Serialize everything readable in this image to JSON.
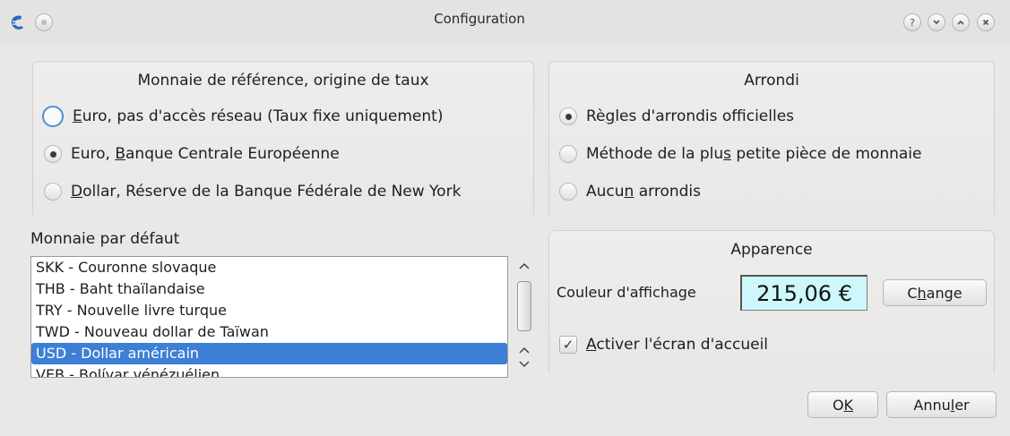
{
  "window": {
    "title": "Configuration",
    "controls": [
      "help-icon",
      "minimize-icon",
      "maximize-icon",
      "close-icon"
    ]
  },
  "reference": {
    "title": "Monnaie de référence, origine de taux",
    "options": [
      {
        "pre": "",
        "key": "E",
        "post": "uro, pas d'accès réseau (Taux fixe uniquement)",
        "checked": false,
        "focused": true
      },
      {
        "pre": "Euro, ",
        "key": "B",
        "post": "anque Centrale Européenne",
        "checked": true,
        "focused": false
      },
      {
        "pre": "",
        "key": "D",
        "post": "ollar, Réserve de la Banque Fédérale de New York",
        "checked": false,
        "focused": false
      }
    ]
  },
  "rounding": {
    "title": "Arrondi",
    "options": [
      {
        "pre": "Rè",
        "key": "g",
        "post": "les d'arrondis officielles",
        "checked": true
      },
      {
        "pre": "Méthode de la plu",
        "key": "s",
        "post": " petite pièce de monnaie",
        "checked": false
      },
      {
        "pre": "Aucu",
        "key": "n",
        "post": " arrondis",
        "checked": false
      }
    ]
  },
  "default_currency": {
    "label": "Monnaie par défaut",
    "items": [
      "SKK - Couronne slovaque",
      "THB - Baht thaïlandaise",
      "TRY - Nouvelle livre turque",
      "TWD - Nouveau dollar de Taïwan",
      "USD - Dollar américain",
      "VEB - Bolívar vénézuélien"
    ],
    "selected_index": 4
  },
  "appearance": {
    "title": "Apparence",
    "color_label": "Couleur d'affichage",
    "sample_value": "215,06 €",
    "sample_bg": "#cdf7fb",
    "change_pre": "C",
    "change_key": "h",
    "change_post": "ange",
    "splash_key": "A",
    "splash_post": "ctiver l'écran d'accueil",
    "splash_checked": true
  },
  "footer": {
    "ok_pre": "O",
    "ok_key": "K",
    "cancel_pre": "Annu",
    "cancel_key": "l",
    "cancel_post": "er"
  },
  "colors": {
    "selection": "#3d7fd5",
    "focus_ring": "#4d8fd6",
    "window_bg": "#e9e8e6"
  }
}
